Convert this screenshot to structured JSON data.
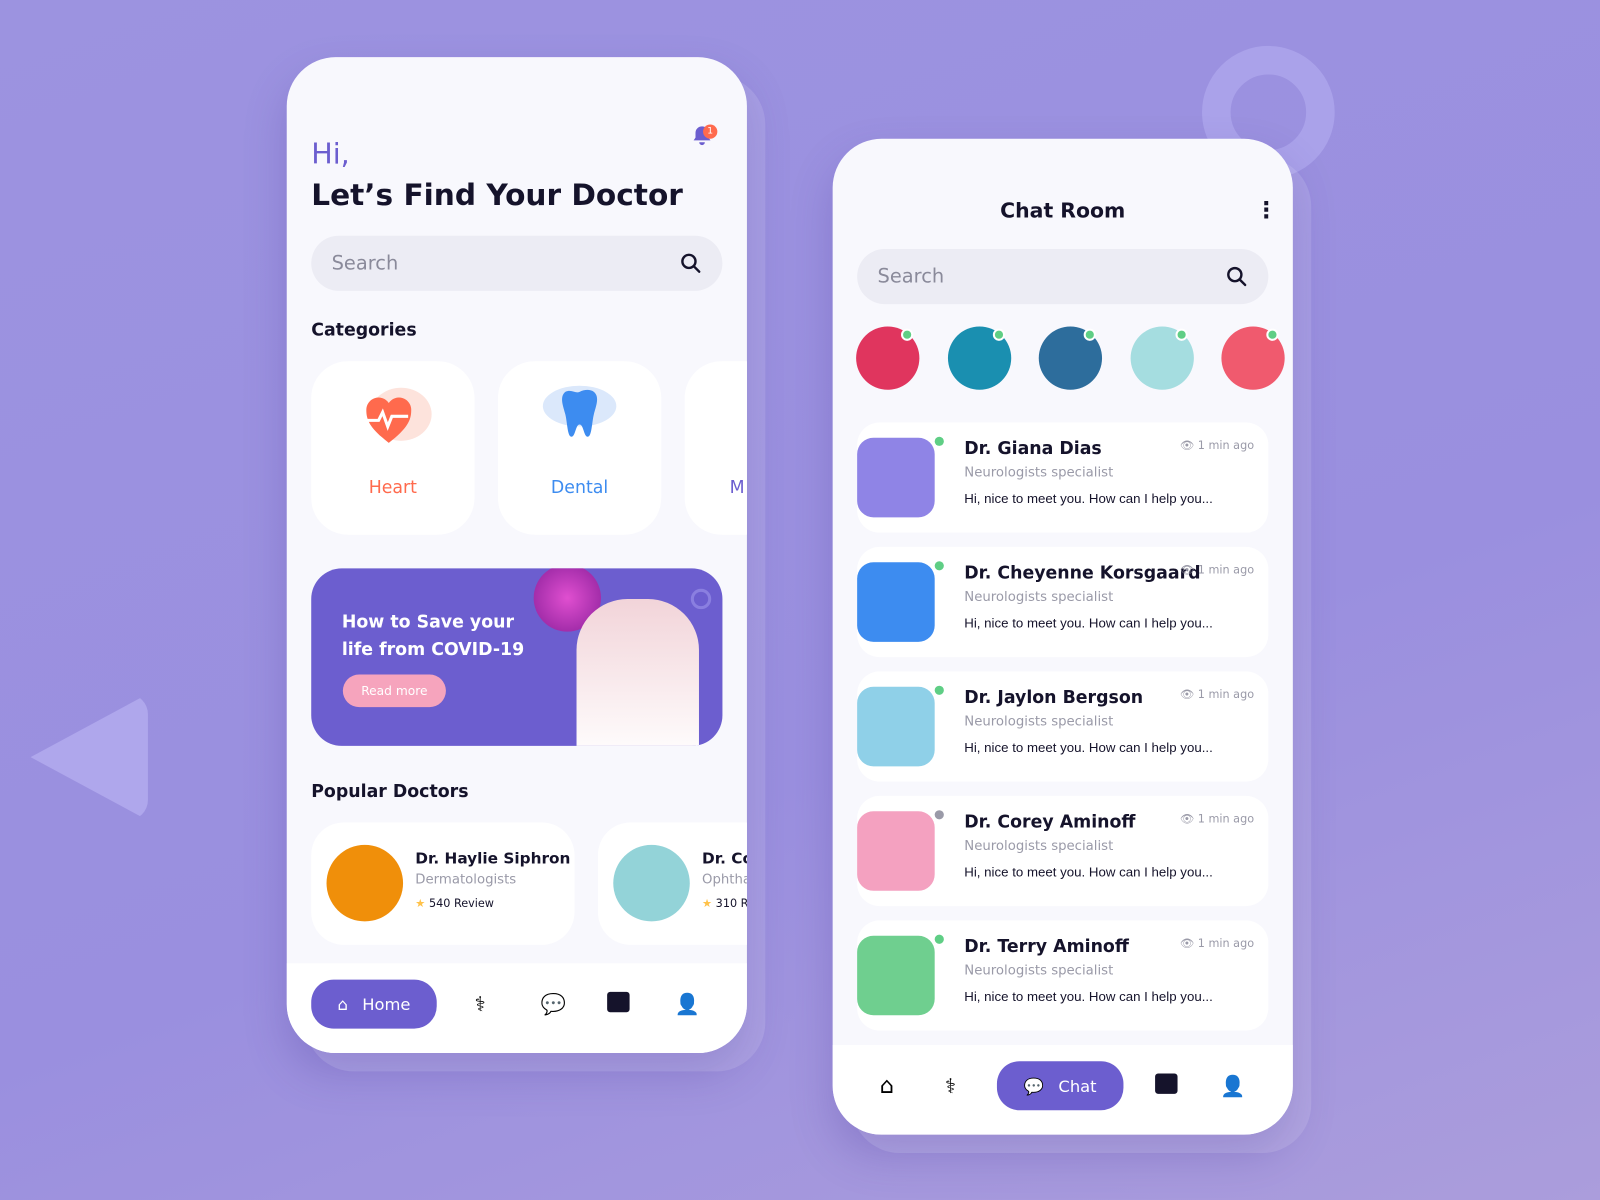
{
  "home": {
    "greeting": "Hi,",
    "title": "Let’s Find Your Doctor",
    "notification_count": "1",
    "search_placeholder": "Search",
    "categories_title": "Categories",
    "categories": [
      {
        "label": "Heart",
        "color": "#ff6a4d"
      },
      {
        "label": "Dental",
        "color": "#3d8cf0"
      },
      {
        "label": "M",
        "color": "#6c5ecf"
      }
    ],
    "banner": {
      "text": "How to Save your life from COVID-19",
      "button": "Read more"
    },
    "popular_title": "Popular Doctors",
    "doctors": [
      {
        "name": "Dr. Haylie Siphron",
        "specialty": "Dermatologists",
        "reviews": "540 Review",
        "color": "#f08f0a"
      },
      {
        "name": "Dr. Co",
        "specialty": "Ophtha",
        "reviews": "310 R",
        "color": "#93d3d8"
      }
    ],
    "nav": {
      "home": "Home"
    }
  },
  "chat": {
    "title": "Chat Room",
    "search_placeholder": "Search",
    "stories": [
      {
        "color": "#e0355e",
        "online": true
      },
      {
        "color": "#1a8fb0",
        "online": true
      },
      {
        "color": "#2d6d9c",
        "online": true
      },
      {
        "color": "#a5dde0",
        "online": true
      },
      {
        "color": "#f05a6e",
        "online": true
      }
    ],
    "items": [
      {
        "name": "Dr. Giana Dias",
        "specialty": "Neurologists specialist",
        "message": "Hi, nice to meet you. How can I help you...",
        "time": "1 min ago",
        "color": "#8f84e6",
        "online": true
      },
      {
        "name": "Dr. Cheyenne Korsgaard",
        "specialty": "Neurologists specialist",
        "message": "Hi, nice to meet you. How can I help you...",
        "time": "1 min ago",
        "color": "#3d8cf0",
        "online": true
      },
      {
        "name": "Dr. Jaylon Bergson",
        "specialty": "Neurologists specialist",
        "message": "Hi, nice to meet you. How can I help you...",
        "time": "1 min ago",
        "color": "#8fd0e8",
        "online": true
      },
      {
        "name": "Dr. Corey Aminoff",
        "specialty": "Neurologists specialist",
        "message": "Hi, nice to meet you. How can I help you...",
        "time": "1 min ago",
        "color": "#f4a1c0",
        "online": false
      },
      {
        "name": "Dr. Terry Aminoff",
        "specialty": "Neurologists specialist",
        "message": "Hi, nice to meet you. How can I help you...",
        "time": "1 min ago",
        "color": "#6fcf8f",
        "online": true
      }
    ],
    "nav": {
      "chat": "Chat"
    }
  },
  "colors": {
    "accent": "#6c5ecf",
    "online": "#5fce85",
    "offline": "#9a9aa8"
  }
}
